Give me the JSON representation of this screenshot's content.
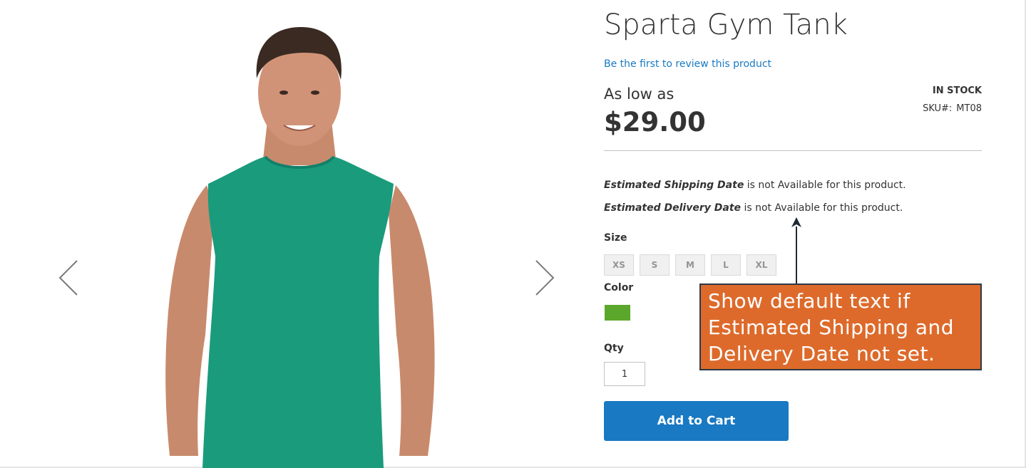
{
  "product": {
    "title": "Sparta Gym Tank",
    "review_link": "Be the first to review this product",
    "price_prefix": "As low as",
    "price": "$29.00",
    "stock_status": "In stock",
    "sku_label": "SKU#:",
    "sku_value": "MT08"
  },
  "estimates": {
    "shipping_bold": "Estimated Shipping Date",
    "shipping_rest": " is not Available for this product.",
    "delivery_bold": "Estimated Delivery Date",
    "delivery_rest": " is not Available for this product."
  },
  "options": {
    "size_label": "Size",
    "sizes": [
      "XS",
      "S",
      "M",
      "L",
      "XL"
    ],
    "color_label": "Color",
    "swatch_color": "#5aa72b",
    "qty_label": "Qty",
    "qty_value": "1"
  },
  "cart": {
    "button_label": "Add to Cart",
    "button_color": "#1979c3"
  },
  "annotation": {
    "line1": "Show default text if",
    "line2": "Estimated Shipping and",
    "line3": "Delivery Date not set.",
    "bg_color": "#dd6a2b"
  },
  "gallery": {
    "prev_icon": "chevron-left-icon",
    "next_icon": "chevron-right-icon",
    "shirt_color": "#1a9b7c"
  }
}
